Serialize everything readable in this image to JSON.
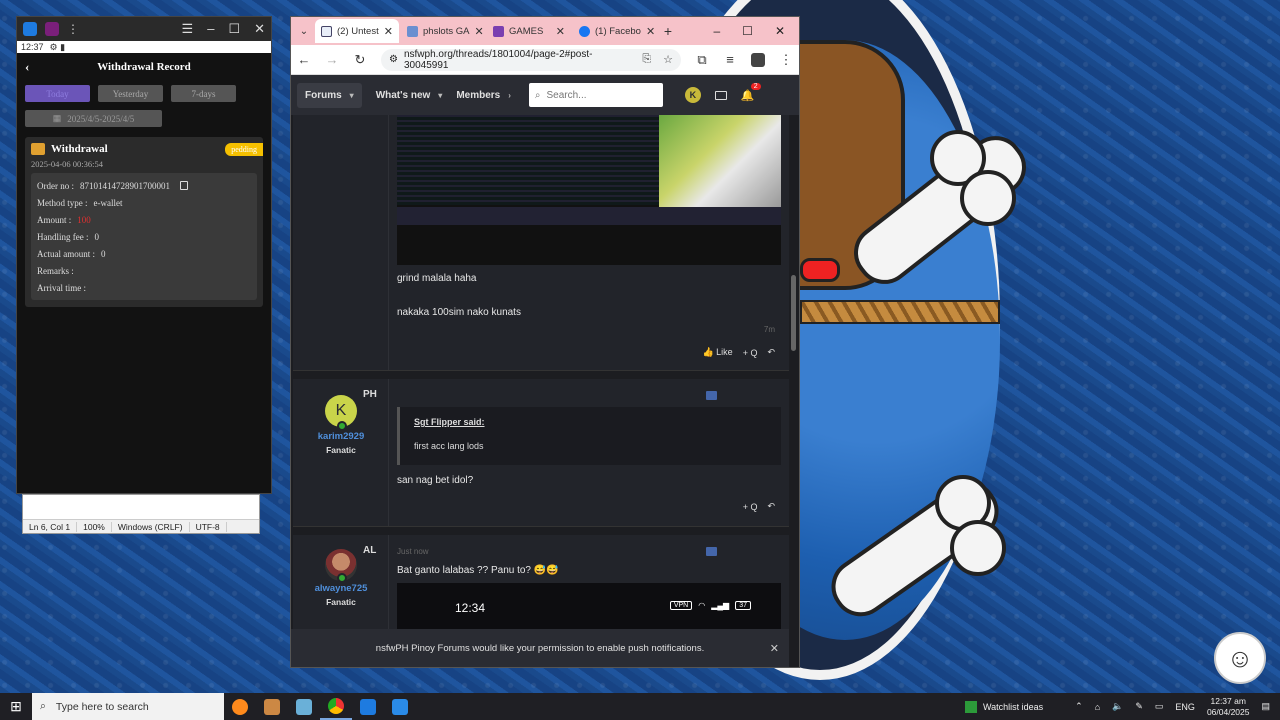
{
  "left_window": {
    "status_time": "12:37",
    "header_title": "Withdrawal Record",
    "filters": [
      "Today",
      "Yesterday",
      "7-days"
    ],
    "date_range": "2025/4/5-2025/4/5",
    "card": {
      "title": "Withdrawal",
      "status": "pedding",
      "timestamp": "2025-04-06 00:36:54",
      "rows": [
        {
          "label": "Order no :",
          "value": "87101414728901700001"
        },
        {
          "label": "Method type :",
          "value": "e-wallet"
        },
        {
          "label": "Amount :",
          "value": "100"
        },
        {
          "label": "Handling fee :",
          "value": "0"
        },
        {
          "label": "Actual amount :",
          "value": "0"
        },
        {
          "label": "Remarks :",
          "value": ""
        },
        {
          "label": "Arrival time :",
          "value": ""
        }
      ]
    }
  },
  "notepad": {
    "position": "Ln 6, Col 1",
    "zoom": "100%",
    "line_endings": "Windows (CRLF)",
    "encoding": "UTF-8"
  },
  "browser": {
    "tabs": [
      {
        "label": "(2) Untest",
        "color": "#e8eef8"
      },
      {
        "label": "phslots GA",
        "color": "#6a8fd0"
      },
      {
        "label": "GAMES",
        "color": "#7a3fb0"
      },
      {
        "label": "(1) Facebo",
        "color": "#1877f2"
      }
    ],
    "url": "nsfwph.org/threads/1801004/page-2#post-30045991",
    "nav": {
      "forums": "Forums",
      "whats_new": "What's new",
      "members": "Members",
      "search_placeholder": "Search...",
      "avatar_letter": "K",
      "notif_count": "2"
    },
    "posts": [
      {
        "lines": [
          "grind malala haha",
          "nakaka 100sim nako kunats"
        ],
        "time": "7m",
        "like": "Like",
        "quote": "+ Q"
      },
      {
        "avatar_letter": "K",
        "flag": "PH",
        "username": "karim2929",
        "user_title": "Fanatic",
        "quote_author": "Sgt Flipper said:",
        "quote_text": "first acc lang lods",
        "text": "san nag bet idol?",
        "quote": "+ Q"
      },
      {
        "flag": "AL",
        "username": "alwayne725",
        "user_title": "Fanatic",
        "meta": "Just now",
        "text": "Bat ganto lalabas ?? Panu to? 😅😅",
        "phone_time": "12:34",
        "phone_vpn": "VPN",
        "phone_battery": "37"
      }
    ],
    "notification": "nsfwPH Pinoy Forums would like your permission to enable push notifications."
  },
  "taskbar": {
    "search_placeholder": "Type here to search",
    "watchlist": "Watchlist ideas",
    "lang": "ENG",
    "time": "12:37 am",
    "date": "06/04/2025"
  }
}
